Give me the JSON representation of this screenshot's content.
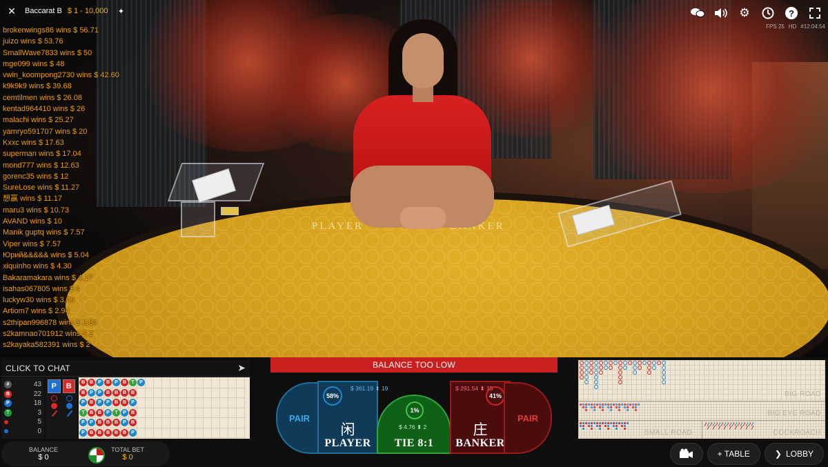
{
  "header": {
    "table_name": "Baccarat B",
    "limits": "$ 1 - 10,000",
    "stream_info": [
      "FPS 25",
      "HD",
      "#12:04:54"
    ]
  },
  "icons": {
    "close": "close-icon",
    "pin": "pin-icon",
    "chat": "chat-bubbles-icon",
    "sound": "speaker-icon",
    "settings": "gear-icon",
    "history": "history-clock-icon",
    "help": "question-icon",
    "fullscreen": "fullscreen-icon"
  },
  "winners": [
    {
      "name": "brokenwings86",
      "amount": "$ 56.71"
    },
    {
      "name": "juizo",
      "amount": "$ 53.76"
    },
    {
      "name": "SmallWave7833",
      "amount": "$ 50"
    },
    {
      "name": "mge099",
      "amount": "$ 48"
    },
    {
      "name": "vwin_koompong2730",
      "amount": "$ 42.60"
    },
    {
      "name": "k9k9k9",
      "amount": "$ 39.68"
    },
    {
      "name": "cemtilmen",
      "amount": "$ 26.08"
    },
    {
      "name": "kentad964410",
      "amount": "$ 26"
    },
    {
      "name": "malachi",
      "amount": "$ 25.27"
    },
    {
      "name": "yamryo591707",
      "amount": "$ 20"
    },
    {
      "name": "Kxxc",
      "amount": "$ 17.63"
    },
    {
      "name": "superman",
      "amount": "$ 17.04"
    },
    {
      "name": "mond777",
      "amount": "$ 12.63"
    },
    {
      "name": "gorenc35",
      "amount": "$ 12"
    },
    {
      "name": "SureLose",
      "amount": "$ 11.27"
    },
    {
      "name": "想赢",
      "amount": "$ 11.17"
    },
    {
      "name": "maru3",
      "amount": "$ 10.73"
    },
    {
      "name": "AVAND",
      "amount": "$ 10"
    },
    {
      "name": "Manik guptq",
      "amount": "$ 7.57"
    },
    {
      "name": "Viper",
      "amount": "$ 7.57"
    },
    {
      "name": "Юрий&&&&&",
      "amount": "$ 5.04"
    },
    {
      "name": "xiquinho",
      "amount": "$ 4.30"
    },
    {
      "name": "Bakaramakara",
      "amount": "$ 4.17"
    },
    {
      "name": "isahas067805",
      "amount": "$ 4"
    },
    {
      "name": "luckyw30",
      "amount": "$ 3.06"
    },
    {
      "name": "Artiom7",
      "amount": "$ 2.94"
    },
    {
      "name": "s2thipan996878",
      "amount": "$ 2.84"
    },
    {
      "name": "s2kamnao701912",
      "amount": "$ 2"
    },
    {
      "name": "s2kayaka582391",
      "amount": "$ 2"
    }
  ],
  "wins_word": "wins",
  "table_felt": {
    "player": "PLAYER",
    "banker": "BANKER"
  },
  "chat": {
    "label": "CLICK TO CHAT"
  },
  "counts": [
    {
      "symbol": "#",
      "value": "43",
      "color": "#5a5a5a"
    },
    {
      "symbol": "B",
      "value": "22",
      "color": "#d42a2a"
    },
    {
      "symbol": "P",
      "value": "18",
      "color": "#1f6fd1"
    },
    {
      "symbol": "T",
      "value": "3",
      "color": "#1f9a33"
    },
    {
      "symbol": "",
      "value": "5",
      "color": "#d42a2a"
    },
    {
      "symbol": "",
      "value": "0",
      "color": "#1f6fd1"
    }
  ],
  "prediction": {
    "player_label": "P",
    "banker_label": "B"
  },
  "bead_road": [
    [
      "B",
      "B",
      "P",
      "B",
      "P",
      "B",
      "T",
      "P"
    ],
    [
      "B",
      "P",
      "P",
      "B",
      "B",
      "B",
      "B"
    ],
    [
      "P",
      "B",
      "P",
      "P",
      "B",
      "B",
      "P"
    ],
    [
      "T",
      "B",
      "B",
      "P",
      "T",
      "P",
      "B"
    ],
    [
      "P",
      "P",
      "B",
      "B",
      "B",
      "P",
      "B"
    ],
    [
      "P",
      "B",
      "B",
      "B",
      "B",
      "B",
      "P"
    ]
  ],
  "balance": {
    "label": "BALANCE",
    "value": "$ 0",
    "total_label": "TOTAL BET",
    "total_value": "$ 0"
  },
  "message": "BALANCE TOO LOW",
  "bets": {
    "player_pair": "PAIR",
    "player_zh": "闲",
    "player": "PLAYER",
    "player_pct": "58%",
    "player_amount": "$ 361.19",
    "player_count": "19",
    "tie": "TIE 8:1",
    "tie_pct": "1%",
    "tie_amount": "$ 4.76",
    "tie_count": "2",
    "banker_zh": "庄",
    "banker": "BANKER",
    "banker_pct": "41%",
    "banker_amount": "$ 291.54",
    "banker_count": "15",
    "banker_pair": "PAIR",
    "player_color": "#1f87c9",
    "banker_color": "#d12424",
    "tie_color": "#2fa638"
  },
  "roads": {
    "big_road": "BIG ROAD",
    "big_eye_road": "BIG EYE ROAD",
    "small_road": "SMALL ROAD",
    "cockroach": "COCKROACH"
  },
  "controls": {
    "video": "video-camera-icon",
    "table": "+ TABLE",
    "lobby": "LOBBY"
  }
}
